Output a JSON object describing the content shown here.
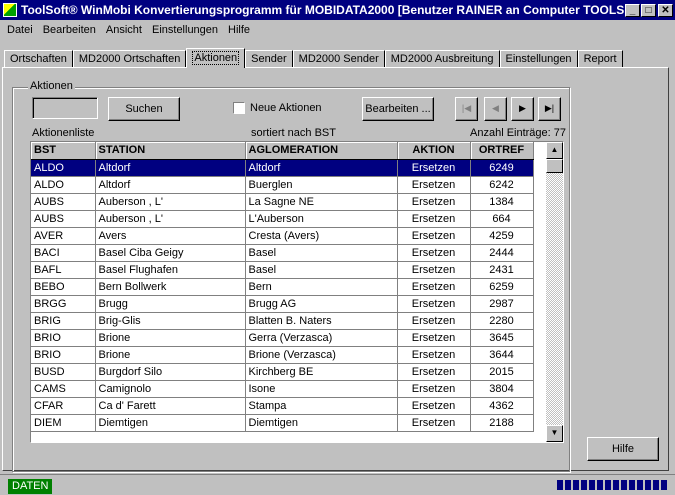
{
  "window": {
    "title": "ToolSoft® WinMobi Konvertierungsprogramm für MOBIDATA2000 [Benutzer RAINER an Computer TOOLS...",
    "minimize": "_",
    "maximize": "□",
    "close": "✕"
  },
  "menu": [
    "Datei",
    "Bearbeiten",
    "Ansicht",
    "Einstellungen",
    "Hilfe"
  ],
  "tabs": [
    "Ortschaften",
    "MD2000 Ortschaften",
    "Aktionen",
    "Sender",
    "MD2000 Sender",
    "MD2000 Ausbreitung",
    "Einstellungen",
    "Report"
  ],
  "active_tab": "Aktionen",
  "group": {
    "title": "Aktionen",
    "search_value": "",
    "search_button": "Suchen",
    "new_actions_label": "Neue Aktionen",
    "new_actions_checked": false,
    "edit_button": "Bearbeiten ...",
    "nav_first": "|◀",
    "nav_prev": "◀",
    "nav_next": "▶",
    "nav_last": "▶|",
    "list_label": "Aktionenliste",
    "sort_label": "sortiert nach BST",
    "count_label": "Anzahl Einträge: 77"
  },
  "table": {
    "columns": [
      "BST",
      "STATION",
      "AGLOMERATION",
      "AKTION",
      "ORTREF"
    ],
    "rows": [
      [
        "ALDO",
        "Altdorf",
        "Altdorf",
        "Ersetzen",
        "6249"
      ],
      [
        "ALDO",
        "Altdorf",
        "Buerglen",
        "Ersetzen",
        "6242"
      ],
      [
        "AUBS",
        "Auberson , L'",
        "La Sagne NE",
        "Ersetzen",
        "1384"
      ],
      [
        "AUBS",
        "Auberson , L'",
        "L'Auberson",
        "Ersetzen",
        "664"
      ],
      [
        "AVER",
        "Avers",
        "Cresta (Avers)",
        "Ersetzen",
        "4259"
      ],
      [
        "BACI",
        "Basel Ciba Geigy",
        "Basel",
        "Ersetzen",
        "2444"
      ],
      [
        "BAFL",
        "Basel Flughafen",
        "Basel",
        "Ersetzen",
        "2431"
      ],
      [
        "BEBO",
        "Bern Bollwerk",
        "Bern",
        "Ersetzen",
        "6259"
      ],
      [
        "BRGG",
        "Brugg",
        "Brugg AG",
        "Ersetzen",
        "2987"
      ],
      [
        "BRIG",
        "Brig-Glis",
        "Blatten B. Naters",
        "Ersetzen",
        "2280"
      ],
      [
        "BRIO",
        "Brione",
        "Gerra (Verzasca)",
        "Ersetzen",
        "3645"
      ],
      [
        "BRIO",
        "Brione",
        "Brione (Verzasca)",
        "Ersetzen",
        "3644"
      ],
      [
        "BUSD",
        "Burgdorf Silo",
        "Kirchberg BE",
        "Ersetzen",
        "2015"
      ],
      [
        "CAMS",
        "Camignolo",
        "Isone",
        "Ersetzen",
        "3804"
      ],
      [
        "CFAR",
        "Ca d' Farett",
        "Stampa",
        "Ersetzen",
        "4362"
      ],
      [
        "DIEM",
        "Diemtigen",
        "Diemtigen",
        "Ersetzen",
        "2188"
      ]
    ],
    "selected_row": 0
  },
  "help_button": "Hilfe",
  "status": {
    "left": "DATEN",
    "progress_segments": 14
  }
}
